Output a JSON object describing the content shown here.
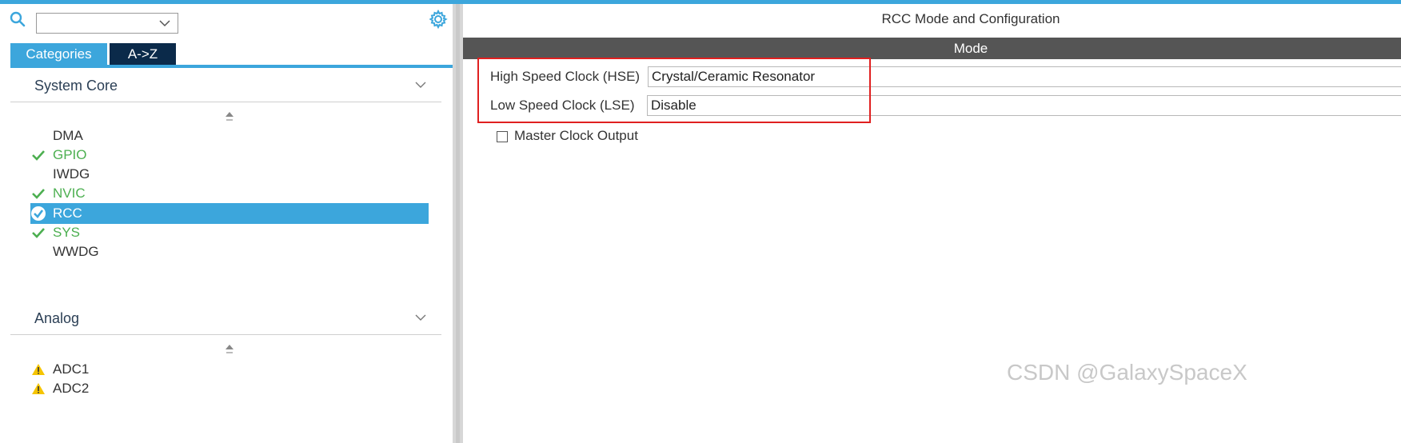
{
  "search": {
    "value": ""
  },
  "tabs": {
    "categories": "Categories",
    "az": "A->Z"
  },
  "sections": [
    {
      "title": "System Core",
      "items": [
        {
          "label": "DMA",
          "status": "none"
        },
        {
          "label": "GPIO",
          "status": "ok"
        },
        {
          "label": "IWDG",
          "status": "none"
        },
        {
          "label": "NVIC",
          "status": "ok"
        },
        {
          "label": "RCC",
          "status": "selected"
        },
        {
          "label": "SYS",
          "status": "ok"
        },
        {
          "label": "WWDG",
          "status": "none"
        }
      ]
    },
    {
      "title": "Analog",
      "items": [
        {
          "label": "ADC1",
          "status": "warning"
        },
        {
          "label": "ADC2",
          "status": "warning"
        }
      ]
    }
  ],
  "panel": {
    "title": "RCC Mode and Configuration",
    "mode_header": "Mode",
    "hse_label": "High Speed Clock (HSE)",
    "hse_value": "Crystal/Ceramic Resonator",
    "lse_label": "Low Speed Clock (LSE)",
    "lse_value": "Disable",
    "mco_label": "Master Clock Output",
    "mco_checked": false
  },
  "watermark": "CSDN @GalaxySpaceX",
  "colors": {
    "accent": "#3ca6dc",
    "ok": "#4caf50",
    "warning": "#f5c400",
    "highlight": "#e02020",
    "mode_bar": "#555555"
  }
}
